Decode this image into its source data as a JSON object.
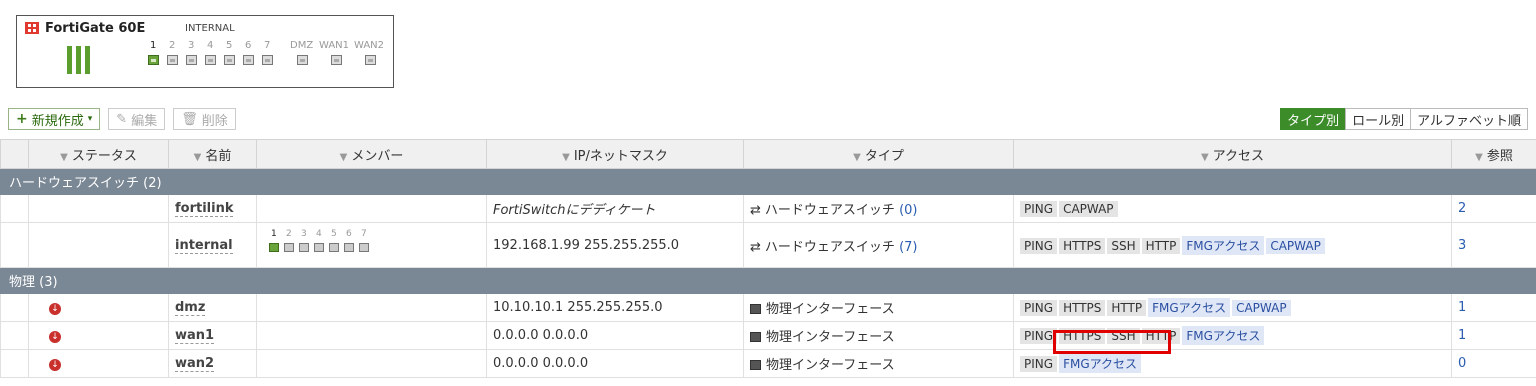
{
  "device": {
    "name": "FortiGate 60E",
    "group_label": "INTERNAL",
    "ports": [
      "1",
      "2",
      "3",
      "4",
      "5",
      "6",
      "7",
      "DMZ",
      "WAN1",
      "WAN2"
    ]
  },
  "toolbar": {
    "create_new": "新規作成",
    "edit": "編集",
    "delete": "削除"
  },
  "view_toggle": [
    "タイプ別",
    "ロール別",
    "アルファベット順"
  ],
  "columns": [
    "ステータス",
    "名前",
    "メンバー",
    "IP/ネットマスク",
    "タイプ",
    "アクセス",
    "参照"
  ],
  "groups": {
    "hardware_switch": "ハードウェアスイッチ (2)",
    "physical": "物理 (3)"
  },
  "rows": [
    {
      "name": "fortilink",
      "members": "",
      "ip": "FortiSwitchにデディケート",
      "type": "ハードウェアスイッチ",
      "type_count": "(0)",
      "access": [
        "PING",
        "CAPWAP"
      ],
      "ref": "2"
    },
    {
      "name": "internal",
      "members_ports": [
        "1",
        "2",
        "3",
        "4",
        "5",
        "6",
        "7"
      ],
      "ip": "192.168.1.99 255.255.255.0",
      "type": "ハードウェアスイッチ",
      "type_count": "(7)",
      "access": [
        "PING",
        "HTTPS",
        "SSH",
        "HTTP",
        "FMGアクセス",
        "CAPWAP"
      ],
      "ref": "3"
    },
    {
      "name": "dmz",
      "ip": "10.10.10.1 255.255.255.0",
      "type": "物理インターフェース",
      "access": [
        "PING",
        "HTTPS",
        "HTTP",
        "FMGアクセス",
        "CAPWAP"
      ],
      "ref": "1"
    },
    {
      "name": "wan1",
      "ip": "0.0.0.0 0.0.0.0",
      "type": "物理インターフェース",
      "access": [
        "PING",
        "HTTPS",
        "SSH",
        "HTTP",
        "FMGアクセス"
      ],
      "ref": "1"
    },
    {
      "name": "wan2",
      "ip": "0.0.0.0 0.0.0.0",
      "type": "物理インターフェース",
      "access": [
        "PING",
        "FMGアクセス"
      ],
      "ref": "0"
    }
  ]
}
